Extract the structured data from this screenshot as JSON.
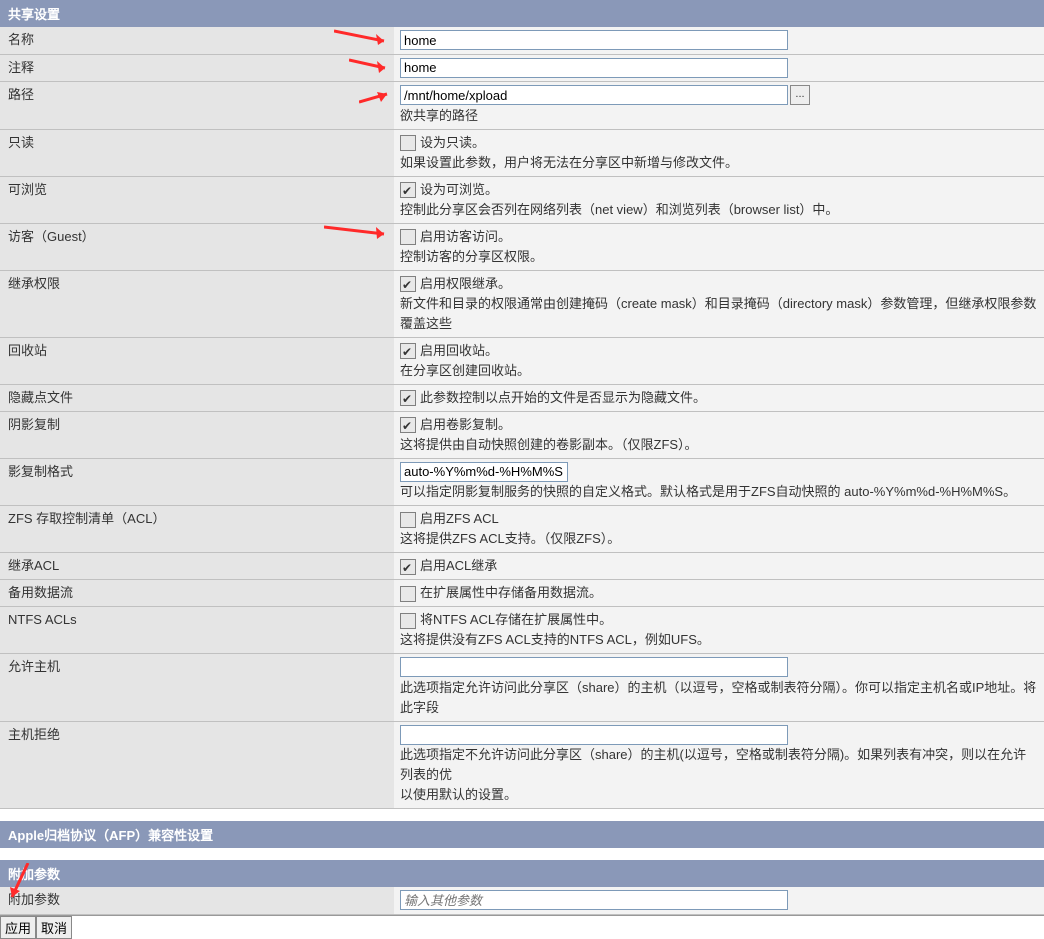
{
  "sections": {
    "share": "共享设置",
    "afp": "Apple归档协议（AFP）兼容性设置",
    "extra": "附加参数"
  },
  "fields": {
    "name": {
      "label": "名称",
      "value": "home"
    },
    "comment": {
      "label": "注释",
      "value": "home"
    },
    "path": {
      "label": "路径",
      "value": "/mnt/home/xpload",
      "hint": "欲共享的路径"
    },
    "readonly": {
      "label": "只读",
      "chk_label": "设为只读。",
      "desc": "如果设置此参数，用户将无法在分享区中新增与修改文件。"
    },
    "browseable": {
      "label": "可浏览",
      "chk_label": "设为可浏览。",
      "desc": "控制此分享区会否列在网络列表（net view）和浏览列表（browser list）中。"
    },
    "guest": {
      "label": "访客（Guest）",
      "chk_label": "启用访客访问。",
      "desc": "控制访客的分享区权限。"
    },
    "inherit_perms": {
      "label": "继承权限",
      "chk_label": "启用权限继承。",
      "desc": "新文件和目录的权限通常由创建掩码（create mask）和目录掩码（directory mask）参数管理，但继承权限参数覆盖这些"
    },
    "recycle": {
      "label": "回收站",
      "chk_label": "启用回收站。",
      "desc": "在分享区创建回收站。"
    },
    "hide_dot": {
      "label": "隐藏点文件",
      "chk_label": "此参数控制以点开始的文件是否显示为隐藏文件。"
    },
    "shadow": {
      "label": "阴影复制",
      "chk_label": "启用卷影复制。",
      "desc": "这将提供由自动快照创建的卷影副本。（仅限ZFS）。"
    },
    "shadow_fmt": {
      "label": "影复制格式",
      "value": "auto-%Y%m%d-%H%M%S",
      "desc": "可以指定阴影复制服务的快照的自定义格式。默认格式是用于ZFS自动快照的 auto-%Y%m%d-%H%M%S。"
    },
    "zfs_acl": {
      "label": "ZFS 存取控制清单（ACL）",
      "chk_label": "启用ZFS ACL",
      "desc": "这将提供ZFS ACL支持。（仅限ZFS）。"
    },
    "inherit_acl": {
      "label": "继承ACL",
      "chk_label": "启用ACL继承"
    },
    "alt_stream": {
      "label": "备用数据流",
      "chk_label": "在扩展属性中存储备用数据流。"
    },
    "ntfs_acl": {
      "label": "NTFS ACLs",
      "chk_label": "将NTFS ACL存储在扩展属性中。",
      "desc": "这将提供没有ZFS ACL支持的NTFS ACL，例如UFS。"
    },
    "hosts_allow": {
      "label": "允许主机",
      "value": "",
      "desc": "此选项指定允许访问此分享区（share）的主机（以逗号，空格或制表符分隔）。你可以指定主机名或IP地址。将此字段"
    },
    "hosts_deny": {
      "label": "主机拒绝",
      "value": "",
      "desc": "此选项指定不允许访问此分享区（share）的主机(以逗号，空格或制表符分隔)。如果列表有冲突，则以在允许列表的优",
      "desc2": "以使用默认的设置。"
    },
    "extra_params": {
      "label": "附加参数",
      "placeholder": "输入其他参数"
    }
  },
  "buttons": {
    "apply": "应用",
    "cancel": "取消",
    "browse": "..."
  }
}
